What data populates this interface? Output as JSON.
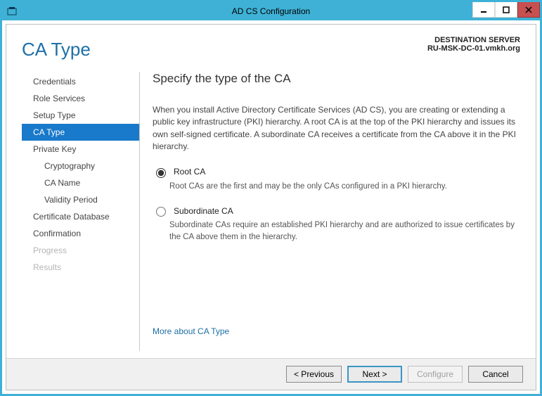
{
  "titlebar": {
    "title": "AD CS Configuration"
  },
  "destination": {
    "label": "DESTINATION SERVER",
    "server": "RU-MSK-DC-01.vmkh.org"
  },
  "page_title": "CA Type",
  "sidebar": {
    "items": [
      {
        "label": "Credentials",
        "indent": false,
        "disabled": false
      },
      {
        "label": "Role Services",
        "indent": false,
        "disabled": false
      },
      {
        "label": "Setup Type",
        "indent": false,
        "disabled": false
      },
      {
        "label": "CA Type",
        "indent": false,
        "disabled": false,
        "active": true
      },
      {
        "label": "Private Key",
        "indent": false,
        "disabled": false
      },
      {
        "label": "Cryptography",
        "indent": true,
        "disabled": false
      },
      {
        "label": "CA Name",
        "indent": true,
        "disabled": false
      },
      {
        "label": "Validity Period",
        "indent": true,
        "disabled": false
      },
      {
        "label": "Certificate Database",
        "indent": false,
        "disabled": false
      },
      {
        "label": "Confirmation",
        "indent": false,
        "disabled": false
      },
      {
        "label": "Progress",
        "indent": false,
        "disabled": true
      },
      {
        "label": "Results",
        "indent": false,
        "disabled": true
      }
    ]
  },
  "main": {
    "heading": "Specify the type of the CA",
    "intro": "When you install Active Directory Certificate Services (AD CS), you are creating or extending a public key infrastructure (PKI) hierarchy. A root CA is at the top of the PKI hierarchy and issues its own self-signed certificate. A subordinate CA receives a certificate from the CA above it in the PKI hierarchy.",
    "options": [
      {
        "id": "root",
        "label": "Root CA",
        "selected": true,
        "desc": "Root CAs are the first and may be the only CAs configured in a PKI hierarchy."
      },
      {
        "id": "sub",
        "label": "Subordinate CA",
        "selected": false,
        "desc": "Subordinate CAs require an established PKI hierarchy and are authorized to issue certificates by the CA above them in the hierarchy."
      }
    ],
    "more_link": "More about CA Type"
  },
  "footer": {
    "previous": "< Previous",
    "next": "Next >",
    "configure": "Configure",
    "cancel": "Cancel"
  }
}
